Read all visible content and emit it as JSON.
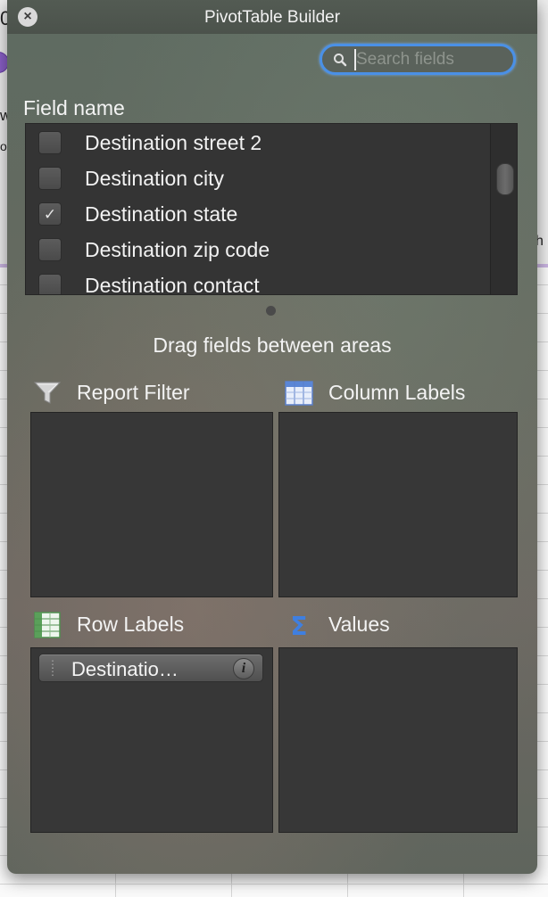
{
  "window": {
    "title": "PivotTable Builder"
  },
  "background": {
    "left_fragments": [
      "0",
      "w",
      "ol",
      "h"
    ]
  },
  "search": {
    "placeholder": "Search fields",
    "value": ""
  },
  "field_section": {
    "label": "Field name",
    "fields": [
      {
        "label": "Destination street 2",
        "checked": false
      },
      {
        "label": "Destination city",
        "checked": false
      },
      {
        "label": "Destination state",
        "checked": true
      },
      {
        "label": "Destination zip code",
        "checked": false
      },
      {
        "label": "Destination contact",
        "checked": false
      }
    ],
    "checkmark": "✓"
  },
  "areas": {
    "caption": "Drag fields between areas",
    "report_filter": {
      "label": "Report Filter",
      "icon": "filter-icon"
    },
    "column_labels": {
      "label": "Column Labels",
      "icon": "column-labels-icon"
    },
    "row_labels": {
      "label": "Row Labels",
      "icon": "row-labels-icon",
      "items": [
        {
          "label": "Destinatio…",
          "info_glyph": "i"
        }
      ]
    },
    "values": {
      "label": "Values",
      "icon": "sigma-icon",
      "glyph": "Σ"
    }
  },
  "colors": {
    "accent": "#4a90e6",
    "panel_bg": "#343434",
    "text": "#f3f3f3"
  }
}
